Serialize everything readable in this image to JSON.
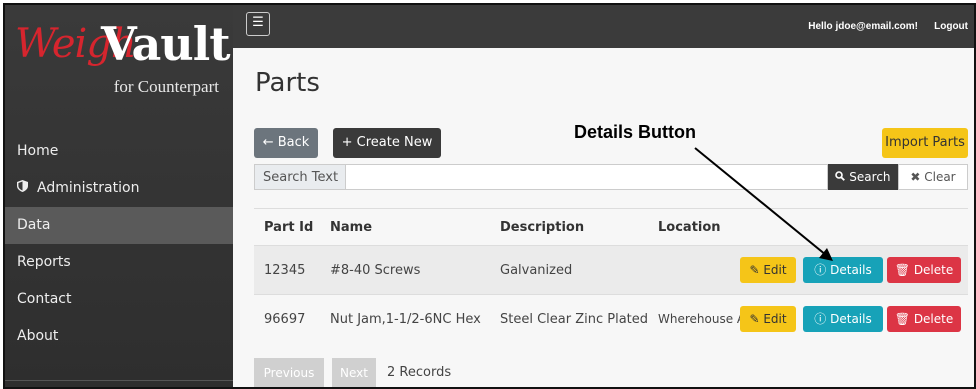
{
  "logo": {
    "weigh": "Weigh",
    "vault": "Vault",
    "tagline": "for Counterpart"
  },
  "sidebar": {
    "items": [
      {
        "label": "Home",
        "icon": ""
      },
      {
        "label": "Administration",
        "icon": "shield-icon"
      },
      {
        "label": "Data",
        "icon": "",
        "active": true
      },
      {
        "label": "Reports",
        "icon": ""
      },
      {
        "label": "Contact",
        "icon": ""
      },
      {
        "label": "About",
        "icon": ""
      }
    ]
  },
  "topbar": {
    "menu_icon": "hamburger-icon",
    "greeting": "Hello jdoe@email.com!",
    "logout": "Logout"
  },
  "page": {
    "title": "Parts"
  },
  "toolbar": {
    "back": "← Back",
    "create": "+ Create New",
    "import": "Import Parts"
  },
  "annotation": {
    "text": "Details Button"
  },
  "search": {
    "label": "Search Text",
    "value": "",
    "search_btn": "Search",
    "clear_btn": "✖ Clear"
  },
  "table": {
    "headers": {
      "id": "Part Id",
      "name": "Name",
      "description": "Description",
      "location": "Location"
    },
    "rows": [
      {
        "id": "12345",
        "name": "#8-40 Screws",
        "description": "Galvanized",
        "location": ""
      },
      {
        "id": "96697",
        "name": "Nut Jam,1-1/2-6NC Hex",
        "description": "Steel Clear Zinc Plated",
        "location": "Wherehouse A"
      }
    ],
    "actions": {
      "edit": "Edit",
      "details": "Details",
      "delete": "Delete"
    }
  },
  "pager": {
    "previous": "Previous",
    "next": "Next",
    "records": "2 Records"
  },
  "colors": {
    "edit": "#f5c518",
    "details": "#17a2b8",
    "delete": "#dc3545",
    "brand_red": "#d6252e"
  }
}
